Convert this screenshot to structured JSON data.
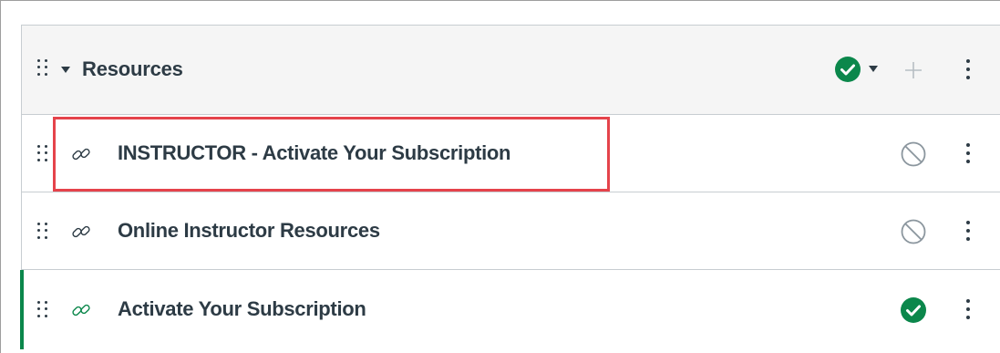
{
  "module": {
    "title": "Resources",
    "status": "published",
    "icons": {
      "drag": "drag-handle-icon",
      "collapse": "caret-down-icon",
      "status": "check-circle-icon",
      "status_menu": "caret-down-icon",
      "add": "plus-icon",
      "menu": "kebab-icon"
    }
  },
  "items": [
    {
      "title": "INSTRUCTOR - Activate Your Subscription",
      "type": "link-icon",
      "status": "unpublished",
      "highlighted": true
    },
    {
      "title": "Online Instructor Resources",
      "type": "link-icon",
      "status": "unpublished",
      "highlighted": false
    },
    {
      "title": "Activate Your Subscription",
      "type": "link-icon",
      "status": "published",
      "highlighted": false
    }
  ],
  "colors": {
    "published": "#0b874b",
    "text": "#2d3b45",
    "muted": "#8b969e",
    "highlight": "#e5434b",
    "header_bg": "#f5f5f5",
    "border": "#c7cdd1"
  }
}
